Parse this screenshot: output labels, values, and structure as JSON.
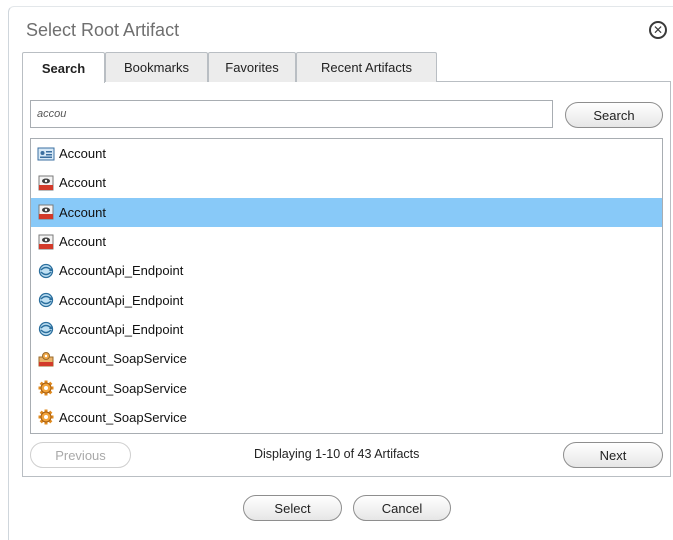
{
  "dialog": {
    "title": "Select Root Artifact",
    "close_icon": "close-circle-icon"
  },
  "tabs": [
    {
      "label": "Search",
      "active": true
    },
    {
      "label": "Bookmarks",
      "active": false
    },
    {
      "label": "Favorites",
      "active": false
    },
    {
      "label": "Recent Artifacts",
      "active": false
    }
  ],
  "search": {
    "value": "accou",
    "button_label": "Search"
  },
  "results": [
    {
      "label": "Account",
      "icon": "entity-card-icon",
      "selected": false
    },
    {
      "label": "Account",
      "icon": "red-document-icon",
      "selected": false
    },
    {
      "label": "Account",
      "icon": "red-document-icon",
      "selected": true
    },
    {
      "label": "Account",
      "icon": "red-document-icon",
      "selected": false
    },
    {
      "label": "AccountApi_Endpoint",
      "icon": "blue-endpoint-icon",
      "selected": false
    },
    {
      "label": "AccountApi_Endpoint",
      "icon": "blue-endpoint-icon",
      "selected": false
    },
    {
      "label": "AccountApi_Endpoint",
      "icon": "blue-endpoint-icon",
      "selected": false
    },
    {
      "label": "Account_SoapService",
      "icon": "service-package-icon",
      "selected": false
    },
    {
      "label": "Account_SoapService",
      "icon": "orange-gear-icon",
      "selected": false
    },
    {
      "label": "Account_SoapService",
      "icon": "orange-gear-icon",
      "selected": false
    }
  ],
  "pagination": {
    "previous_label": "Previous",
    "previous_enabled": false,
    "status_text": "Displaying 1-10 of 43 Artifacts",
    "next_label": "Next"
  },
  "footer": {
    "select_label": "Select",
    "cancel_label": "Cancel"
  },
  "colors": {
    "selected_row": "#88c9f8",
    "border": "#a8adb2"
  }
}
